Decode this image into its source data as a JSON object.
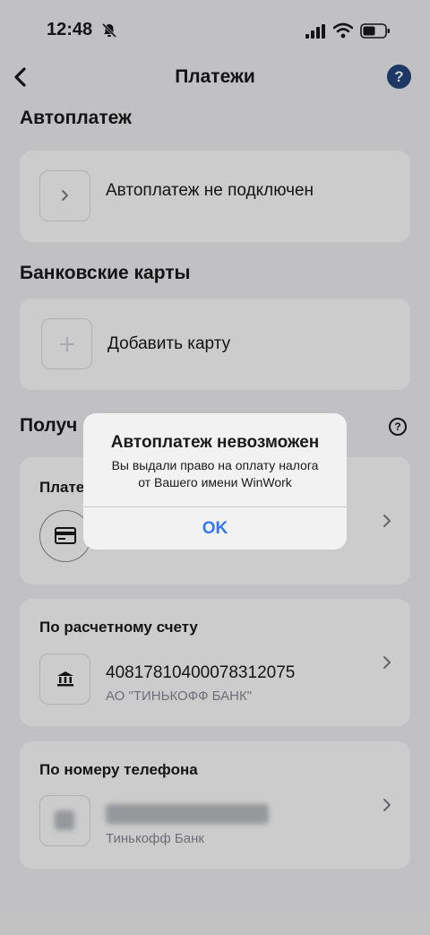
{
  "status_bar": {
    "time": "12:48"
  },
  "nav": {
    "title": "Платежи",
    "help_label": "?"
  },
  "autopay": {
    "section_title": "Автоплатеж",
    "status_text": "Автоплатеж не подключен"
  },
  "bank_cards": {
    "section_title": "Банковские карты",
    "add_label": "Добавить карту"
  },
  "receive": {
    "section_title": "Получ",
    "info_label": "?",
    "card_option_title": "Плате"
  },
  "account": {
    "title": "По расчетному счету",
    "number": "40817810400078312075",
    "bank": "АО \"ТИНЬКОФФ БАНК\""
  },
  "phone": {
    "title": "По номеру телефона",
    "bank": "Тинькофф Банк"
  },
  "alert": {
    "title": "Автоплатеж невозможен",
    "line1": "Вы выдали право на оплату налога",
    "line2": "от Вашего имени WinWork",
    "ok_label": "OK"
  },
  "colors": {
    "accent": "#3478f6",
    "help_bg": "#25477f",
    "background": "#f2f2f4"
  }
}
